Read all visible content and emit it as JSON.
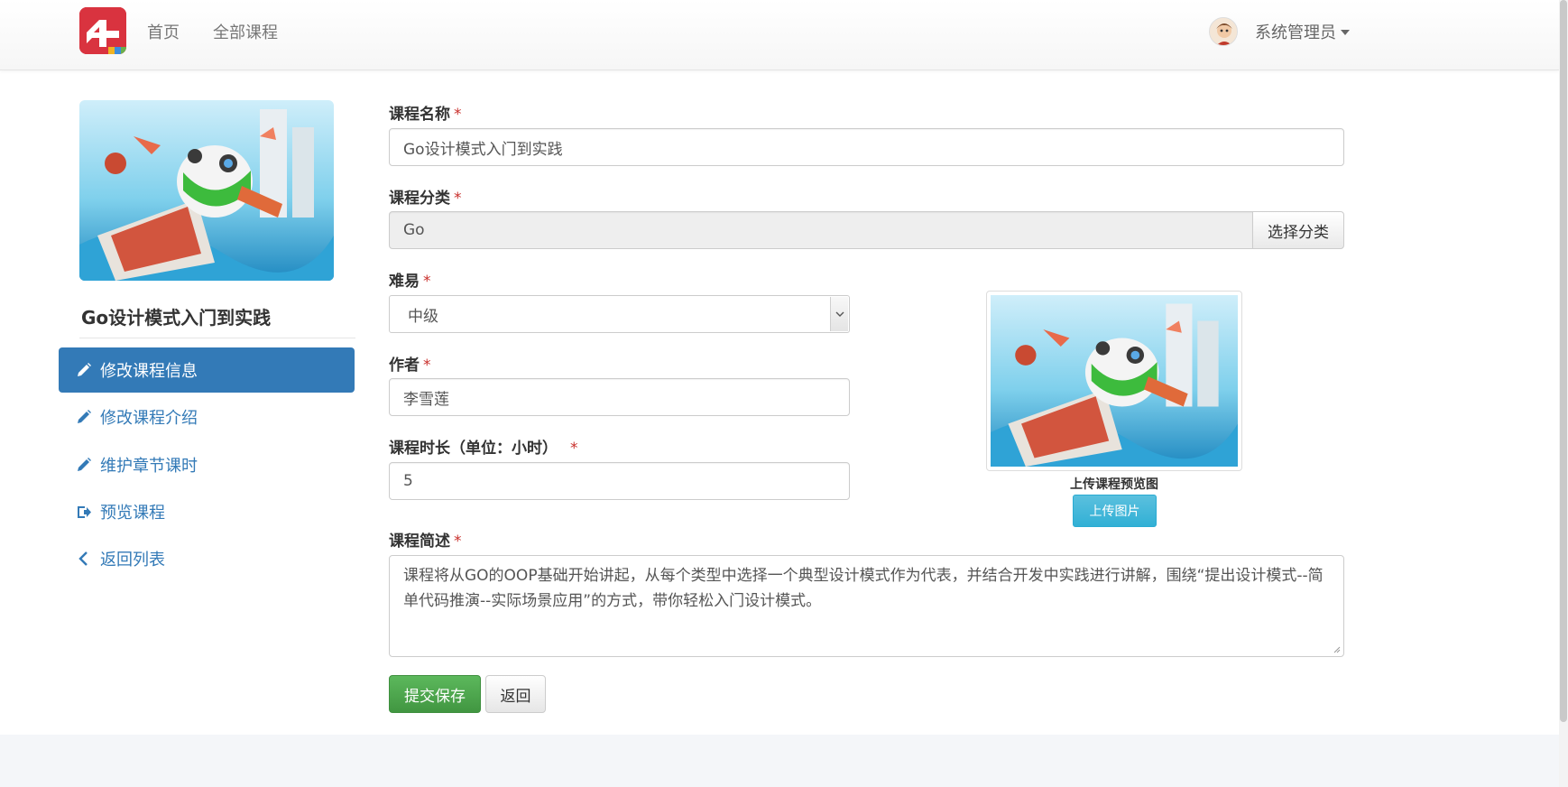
{
  "navbar": {
    "logo_icon": "app-logo-icon",
    "links": [
      {
        "label": "首页"
      },
      {
        "label": "全部课程"
      }
    ],
    "user": {
      "name": "系统管理员",
      "avatar_icon": "user-avatar",
      "caret_icon": "caret-down-icon"
    }
  },
  "sidebar": {
    "course_title": "Go设计模式入门到实践",
    "items": [
      {
        "label": "修改课程信息",
        "icon": "pencil-icon",
        "active": true
      },
      {
        "label": "修改课程介绍",
        "icon": "pencil-icon",
        "active": false
      },
      {
        "label": "维护章节课时",
        "icon": "pencil-icon",
        "active": false
      },
      {
        "label": "预览课程",
        "icon": "share-icon",
        "active": false
      },
      {
        "label": "返回列表",
        "icon": "chevron-left-icon",
        "active": false
      }
    ]
  },
  "form": {
    "name": {
      "label": "课程名称",
      "required": "*",
      "value": "Go设计模式入门到实践"
    },
    "category": {
      "label": "课程分类",
      "required": "*",
      "value": "Go",
      "button": "选择分类"
    },
    "difficulty": {
      "label": "难易",
      "required": "*",
      "selected": "中级"
    },
    "author": {
      "label": "作者",
      "required": "*",
      "value": "李雪莲"
    },
    "duration": {
      "label": "课程时长（单位：小时）",
      "required": "*",
      "value": "5"
    },
    "summary": {
      "label": "课程简述",
      "required": "*",
      "value": "课程将从GO的OOP基础开始讲起，从每个类型中选择一个典型设计模式作为代表，并结合开发中实践进行讲解，围绕“提出设计模式--简单代码推演--实际场景应用”的方式，带你轻松入门设计模式。"
    },
    "submit": "提交保存",
    "back": "返回"
  },
  "preview": {
    "caption": "上传课程预览图",
    "upload_button": "上传图片"
  },
  "colors": {
    "primary": "#337ab7",
    "success": "#5cb85c",
    "info": "#5bc0de",
    "danger": "#c9302c",
    "logo_red": "#d9333f"
  }
}
